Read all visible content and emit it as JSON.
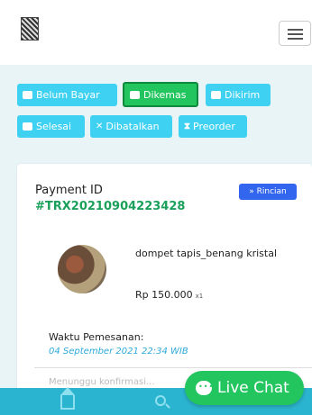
{
  "header": {
    "logo_alt": "logo",
    "menu_icon": "hamburger-icon"
  },
  "tabs": [
    {
      "label": "Belum Bayar",
      "icon": "card-icon",
      "active": false
    },
    {
      "label": "Dikemas",
      "icon": "box-icon",
      "active": true
    },
    {
      "label": "Dikirim",
      "icon": "truck-icon",
      "active": false
    },
    {
      "label": "Selesai",
      "icon": "check-icon",
      "active": false
    },
    {
      "label": "Dibatalkan",
      "icon": "x-icon",
      "active": false
    },
    {
      "label": "Preorder",
      "icon": "hourglass-icon",
      "active": false
    }
  ],
  "order": {
    "payment_label": "Payment ID",
    "payment_id": "#TRX20210904223428",
    "rincian_label": "Rincian",
    "product_name": "dompet tapis_benang kristal",
    "price": "Rp 150.000",
    "qty": "x1",
    "time_label": "Waktu Pemesanan:",
    "time_value": "04 September 2021 22:34 WIB",
    "faded": "Menunggu konfirmasi..."
  },
  "bottom_nav": {
    "home_icon": "home-icon",
    "search_icon": "search-icon"
  },
  "live_chat_label": "Live Chat",
  "colors": {
    "tab": "#3fd1f2",
    "active_tab": "#22c55e",
    "accent_green": "#1aa05a",
    "nav": "#2bb4cf",
    "rincian": "#3366ee"
  }
}
